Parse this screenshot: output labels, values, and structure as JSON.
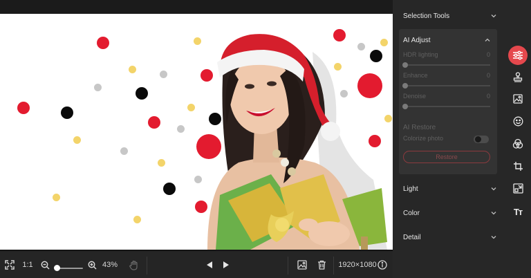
{
  "colors": {
    "accent": "#e5484d",
    "panel": "#272727",
    "card": "#333333",
    "dot_red": "#e31b2f",
    "dot_black": "#0a0a0a",
    "dot_gray": "#c7c7c7",
    "dot_yellow": "#f3d46a"
  },
  "toolbar": {
    "fit_icon": "fit-screen-icon",
    "ratio_label": "1:1",
    "zoom_level": 0.43,
    "zoom_label": "43%",
    "pan_icon": "hand-icon",
    "prev_icon": "triangle-left-icon",
    "next_icon": "triangle-right-icon",
    "image_icon": "image-icon",
    "delete_icon": "trash-icon",
    "dimensions": "1920×1080",
    "info_icon": "info-icon"
  },
  "panel": {
    "selection_tools": "Selection Tools",
    "ai_adjust": {
      "title": "AI Adjust",
      "sliders": [
        {
          "label": "HDR lighting",
          "value": "0"
        },
        {
          "label": "Enhance",
          "value": "0"
        },
        {
          "label": "Denoise",
          "value": "0"
        }
      ],
      "restore_title": "AI Restore",
      "colorize_label": "Colorize photo",
      "colorize_on": false,
      "restore_button": "Restore"
    },
    "light": "Light",
    "color": "Color",
    "detail": "Detail"
  },
  "rail": [
    {
      "icon": "sliders-icon",
      "active": true
    },
    {
      "icon": "stamp-icon",
      "active": false
    },
    {
      "icon": "image-frame-icon",
      "active": false
    },
    {
      "icon": "smile-icon",
      "active": false
    },
    {
      "icon": "color-circles-icon",
      "active": false
    },
    {
      "icon": "crop-icon",
      "active": false
    },
    {
      "icon": "resize-icon",
      "active": false
    },
    {
      "icon": "text-icon",
      "active": false,
      "glyph": "Tт"
    }
  ]
}
